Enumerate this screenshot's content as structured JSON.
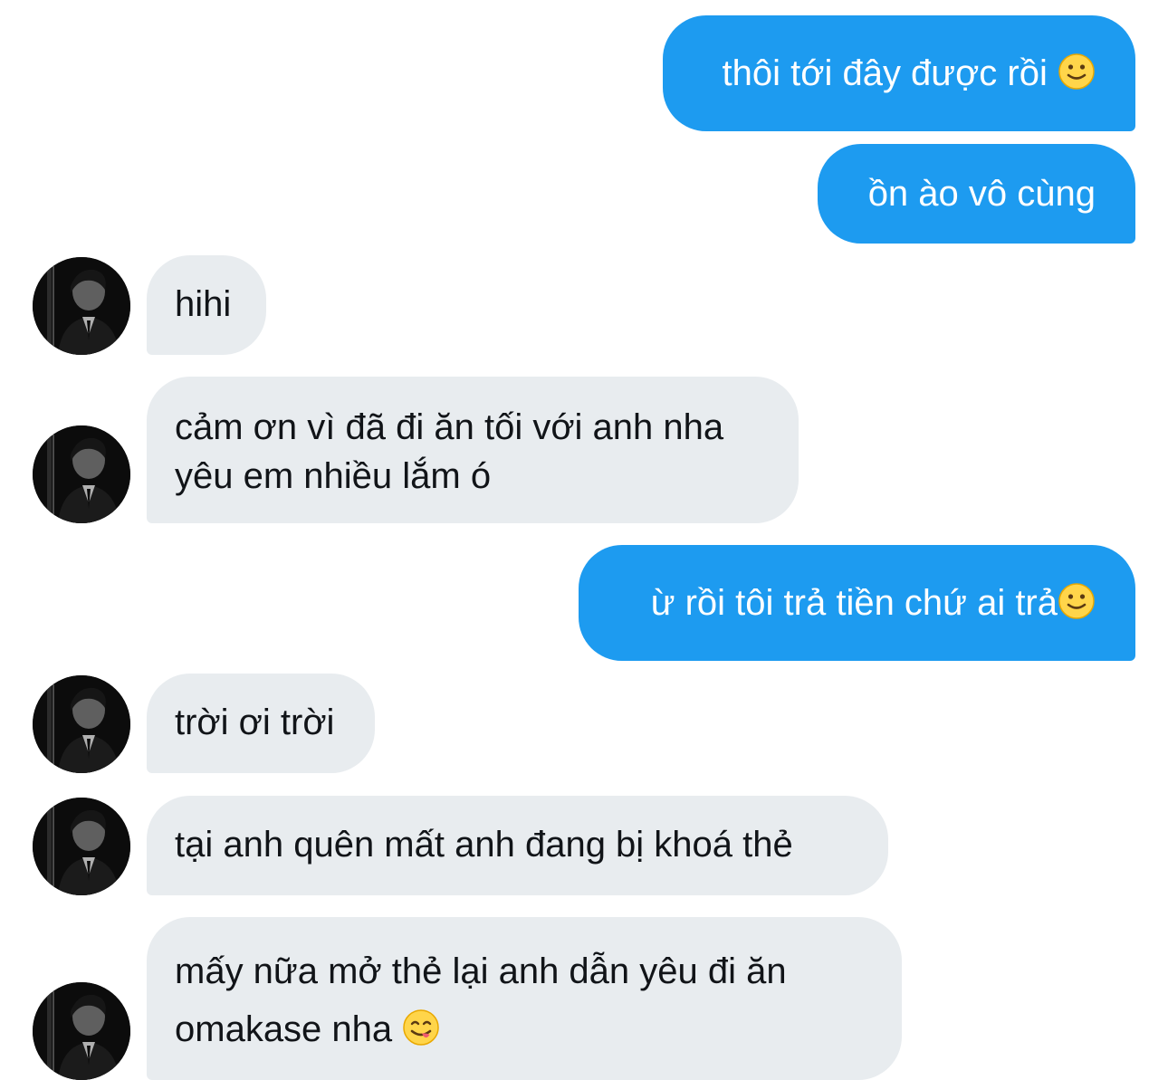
{
  "conversation": {
    "messages": [
      {
        "from": "me",
        "text": "thôi tới đây được rồi ",
        "emoji": "slightly-smiling-face"
      },
      {
        "from": "me",
        "text": "ồn ào vô cùng"
      },
      {
        "from": "them",
        "text": "hihi"
      },
      {
        "from": "them",
        "lines": [
          "cảm ơn vì đã đi ăn tối với anh nha",
          "yêu em nhiều lắm ó"
        ]
      },
      {
        "from": "me",
        "text": "ừ rồi tôi trả tiền chứ ai trả",
        "emoji": "slightly-smiling-face"
      },
      {
        "from": "them",
        "text": "trời ơi trời"
      },
      {
        "from": "them",
        "text": "tại anh quên mất anh đang bị khoá thẻ"
      },
      {
        "from": "them",
        "lines": [
          "mấy nữa mở thẻ lại anh dẫn yêu đi ăn",
          "omakase nha "
        ],
        "emoji": "face-savoring-food"
      }
    ]
  },
  "colors": {
    "sent_bubble": "#1d9bf0",
    "received_bubble": "#e8ecef",
    "sent_text": "#ffffff",
    "received_text": "#111418"
  },
  "icons": {
    "avatar": "profile-photo-avatar",
    "smile": "slightly-smiling-face-emoji",
    "yum": "face-savoring-food-emoji"
  }
}
